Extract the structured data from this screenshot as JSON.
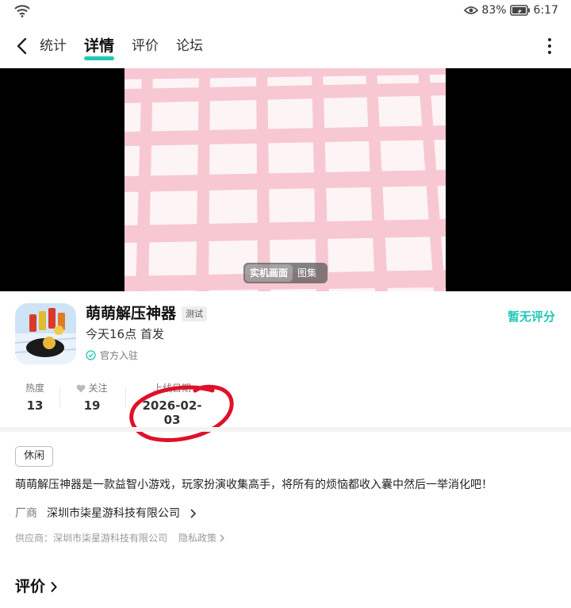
{
  "status_bar": {
    "battery_percent": "83%",
    "time": "6:17"
  },
  "nav": {
    "tabs": [
      {
        "label": "统计",
        "active": false
      },
      {
        "label": "详情",
        "active": true
      },
      {
        "label": "评价",
        "active": false
      },
      {
        "label": "论坛",
        "active": false
      }
    ]
  },
  "media": {
    "toggle": [
      "实机画面",
      "图集"
    ],
    "active_index": 0
  },
  "app": {
    "name": "萌萌解压神器",
    "tag": "测试",
    "release": "今天16点 首发",
    "official": "官方入驻",
    "rating": "暂无评分"
  },
  "stats": [
    {
      "label": "热度",
      "value": "13"
    },
    {
      "label": "关注",
      "value": "19"
    },
    {
      "label": "上线日期",
      "value": "2026-02-03"
    }
  ],
  "details": {
    "genre": "休闲",
    "description": "萌萌解压神器是一款益智小游戏，玩家扮演收集高手，将所有的烦恼都收入囊中然后一举消化吧！",
    "maker_label": "厂商",
    "maker": "深圳市柒星游科技有限公司",
    "supplier": "供应商：深圳市柒星游科技有限公司",
    "privacy": "隐私政策"
  },
  "reviews": {
    "title": "评价"
  },
  "colors": {
    "accent": "#21c8b4",
    "annotation": "#e0102a"
  },
  "icons": [
    "wifi-icon",
    "eye-icon",
    "battery-icon",
    "back-icon",
    "more-icon",
    "verified-icon",
    "heart-icon",
    "chevron-right-icon"
  ]
}
